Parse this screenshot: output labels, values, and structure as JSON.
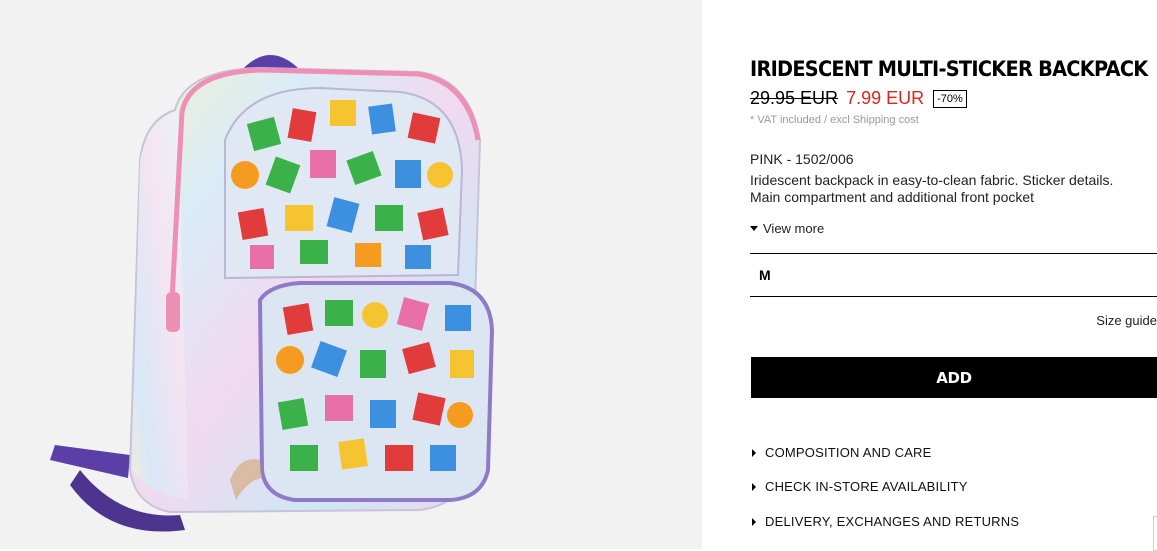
{
  "product": {
    "title": "IRIDESCENT MULTI-STICKER BACKPACK",
    "old_price": "29.95 EUR",
    "new_price": "7.99 EUR",
    "discount": "-70%",
    "vat_note": "* VAT included / excl Shipping cost",
    "color_ref": "PINK - 1502/006",
    "description": "Iridescent backpack in easy-to-clean fabric. Sticker details. Main compartment and additional front pocket",
    "view_more": "View more",
    "selected_size": "M",
    "size_guide": "Size guide",
    "add_label": "ADD"
  },
  "accordion": [
    {
      "label": "COMPOSITION AND CARE"
    },
    {
      "label": "CHECK IN-STORE AVAILABILITY"
    },
    {
      "label": "DELIVERY, EXCHANGES AND RETURNS"
    }
  ],
  "colors": {
    "sale_red": "#e0231c",
    "image_bg": "#f2f2f2",
    "strap_purple": "#5b3fa6",
    "zipper_pink": "#ee8fb6"
  },
  "icons": [
    "caret-down-icon",
    "caret-right-icon"
  ]
}
